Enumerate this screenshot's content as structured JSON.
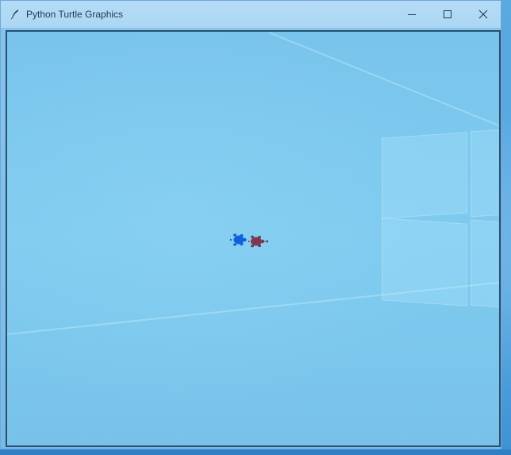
{
  "window": {
    "title": "Python Turtle Graphics",
    "icon": "feather-icon"
  },
  "controls": {
    "minimize": "minimize-icon",
    "maximize": "maximize-icon",
    "close": "close-icon"
  },
  "canvas": {
    "background": "#7cc6ed",
    "turtles": [
      {
        "name": "turtle-blue",
        "color": "#1060d8",
        "heading": "left"
      },
      {
        "name": "turtle-maroon",
        "color": "#7a3a52",
        "heading": "right"
      }
    ]
  }
}
